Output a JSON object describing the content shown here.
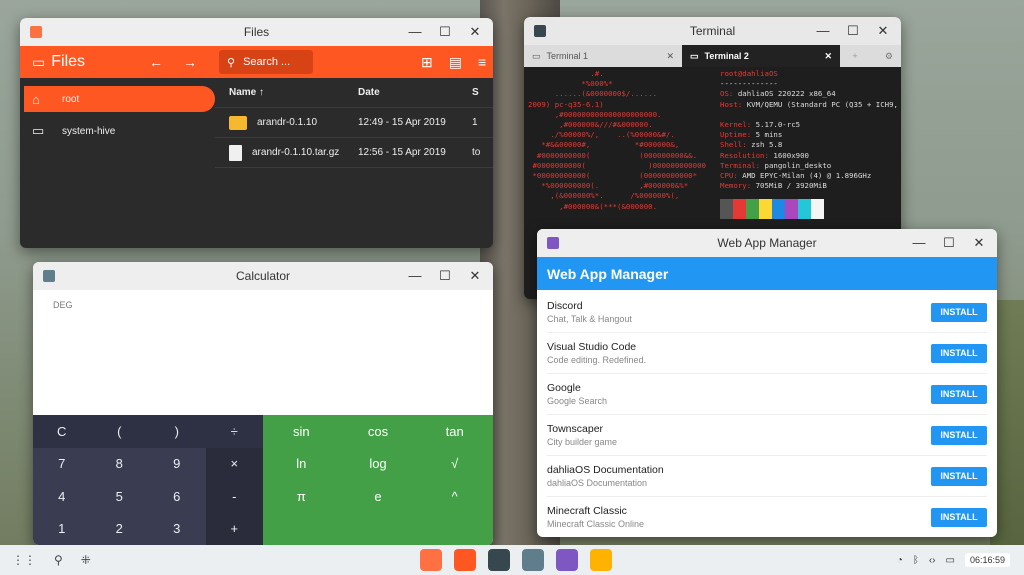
{
  "files": {
    "window_title": "Files",
    "app_title": "Files",
    "search_placeholder": "Search ...",
    "sidebar": [
      {
        "label": "root"
      },
      {
        "label": "system-hive"
      }
    ],
    "columns": [
      "Name ↑",
      "Date",
      "S"
    ],
    "rows": [
      {
        "name": "arandr-0.1.10",
        "date": "12:49 - 15 Apr 2019",
        "extra": "1"
      },
      {
        "name": "arandr-0.1.10.tar.gz",
        "date": "12:56 - 15 Apr 2019",
        "extra": "to"
      }
    ]
  },
  "terminal": {
    "window_title": "Terminal",
    "tabs": [
      {
        "label": "Terminal 1"
      },
      {
        "label": "Terminal 2"
      }
    ],
    "art": "              .#.\n            *%000%*\n      ......(&0000000$/......\n2009) pc-q35-6.1)\n      ,#000000000000000000000.\n       ,#000000&///#&000000.\n     ./%00000%/,    ..(%00000&#/.\n   *#&&00000#,          *#000000&,\n  #0000000000(           (000000000&&.\n #0000000000(              )000000000000\n *00000000000(           (00000000000*\n   *%000000000(.         ,#000000&%*\n     ,(&000000%*.      /%000000%(,\n       ,#000000&(***(&000000.",
    "info": {
      "user": "root@dahliaOS",
      "sep": "-------------",
      "os": "dahliaOS 220222 x86_64",
      "host": "KVM/QEMU (Standard PC (Q35 + ICH9,",
      "kernel": "5.17.0-rc5",
      "uptime": "5 mins",
      "shell": "zsh 5.8",
      "resolution": "1600x900",
      "terminal": "pangolin_deskto",
      "cpu": "AMD EPYC-Milan (4) @ 1.896GHz",
      "memory": "705MiB / 3920MiB"
    },
    "swatch_colors": [
      "#555555",
      "#e53935",
      "#43a047",
      "#fdd835",
      "#1e88e5",
      "#ab47bc",
      "#26c6da",
      "#f5f5f5"
    ]
  },
  "calculator": {
    "window_title": "Calculator",
    "mode": "DEG",
    "numpad": [
      "C",
      "(",
      ")",
      "÷",
      "7",
      "8",
      "9",
      "×",
      "4",
      "5",
      "6",
      "-",
      "1",
      "2",
      "3",
      "+"
    ],
    "sci": [
      "sin",
      "cos",
      "tan",
      "ln",
      "log",
      "√",
      "π",
      "e",
      "^",
      "",
      "",
      ""
    ]
  },
  "wam": {
    "window_title": "Web App Manager",
    "header": "Web App Manager",
    "install_label": "INSTALL",
    "apps": [
      {
        "name": "Discord",
        "desc": "Chat, Talk & Hangout"
      },
      {
        "name": "Visual Studio Code",
        "desc": "Code editing. Redefined."
      },
      {
        "name": "Google",
        "desc": "Google Search"
      },
      {
        "name": "Townscaper",
        "desc": "City builder game"
      },
      {
        "name": "dahliaOS Documentation",
        "desc": "dahliaOS Documentation"
      },
      {
        "name": "Minecraft Classic",
        "desc": "Minecraft Classic Online"
      }
    ]
  },
  "taskbar": {
    "clock": "06:16:59",
    "apps": [
      {
        "name": "files-app-icon",
        "color": "#ff7043"
      },
      {
        "name": "web-browser-icon",
        "color": "#ff5722"
      },
      {
        "name": "terminal-app-icon",
        "color": "#37474f"
      },
      {
        "name": "calculator-app-icon",
        "color": "#607d8b"
      },
      {
        "name": "web-app-manager-icon",
        "color": "#7e57c2"
      },
      {
        "name": "color-wheel-icon",
        "color": "#ffb300"
      }
    ]
  }
}
